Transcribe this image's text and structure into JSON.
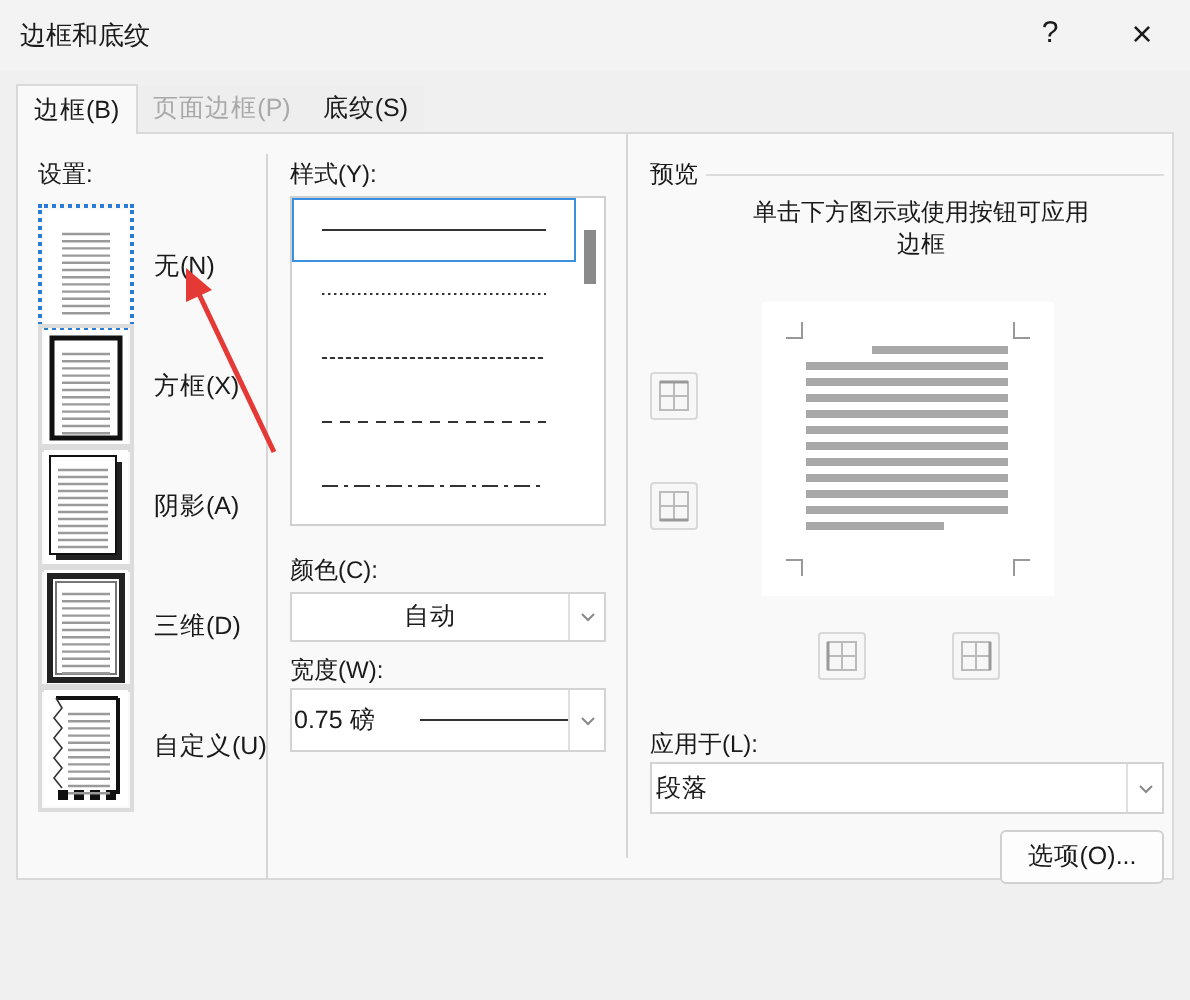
{
  "window": {
    "title": "边框和底纹",
    "help": "?",
    "close": "×"
  },
  "tabs": [
    {
      "label": "边框(B)",
      "selected": true,
      "disabled": false
    },
    {
      "label": "页面边框(P)",
      "selected": false,
      "disabled": true
    },
    {
      "label": "底纹(S)",
      "selected": false,
      "disabled": false
    }
  ],
  "settings": {
    "label": "设置:",
    "items": [
      {
        "label": "无(N)",
        "kind": "none",
        "selected": true
      },
      {
        "label": "方框(X)",
        "kind": "box",
        "selected": false
      },
      {
        "label": "阴影(A)",
        "kind": "shadow",
        "selected": false
      },
      {
        "label": "三维(D)",
        "kind": "threed",
        "selected": false
      },
      {
        "label": "自定义(U)",
        "kind": "custom",
        "selected": false
      }
    ]
  },
  "style": {
    "label": "样式(Y):",
    "items": [
      {
        "kind": "solid",
        "selected": true
      },
      {
        "kind": "dotted",
        "selected": false
      },
      {
        "kind": "finedash",
        "selected": false
      },
      {
        "kind": "dashed",
        "selected": false
      },
      {
        "kind": "dashdot",
        "selected": false
      }
    ]
  },
  "color": {
    "label": "颜色(C):",
    "value": "自动"
  },
  "width": {
    "label": "宽度(W):",
    "value": "0.75 磅"
  },
  "preview": {
    "label": "预览",
    "hint": "单击下方图示或使用按钮可应用边框"
  },
  "apply_to": {
    "label": "应用于(L):",
    "value": "段落"
  },
  "options_button": "选项(O)...",
  "annotation": {
    "kind": "arrow"
  }
}
